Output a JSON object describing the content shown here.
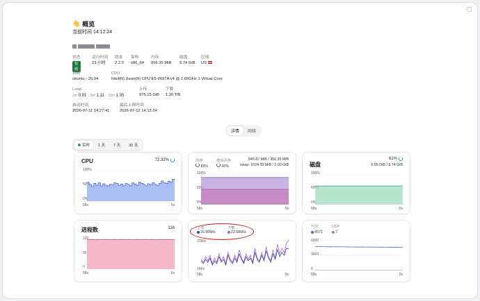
{
  "overview": {
    "title": "概览",
    "time_label": "当前时间",
    "time": "14:12:24"
  },
  "info": {
    "status": {
      "label": "状态",
      "value": "在线"
    },
    "uptime": {
      "label": "运行时间",
      "value": "23 小时"
    },
    "version": {
      "label": "版本",
      "value": "2.2.3"
    },
    "arch": {
      "label": "架构",
      "value": "x86_64"
    },
    "memory": {
      "label": "内存",
      "value": "956.35 MiB"
    },
    "disk": {
      "label": "磁盘",
      "value": "9.74 GiB"
    },
    "region": {
      "label": "区域",
      "value": "US"
    },
    "system": {
      "label": "系统",
      "value": "ubuntu - 26.04"
    },
    "cpu": {
      "label": "CPU",
      "value": "Intel(R) Xeon(R) CPU E5-2697A v4 @ 2.60GHz 1 Virtual Core"
    },
    "load": {
      "label": "Load",
      "l1": "1m",
      "v1": "0.91",
      "l5": "5m",
      "v5": "1.11",
      "l15": "15m",
      "v15": "1.35"
    },
    "upload": {
      "label": "上传",
      "value": "976.15 GiB"
    },
    "download": {
      "label": "下载",
      "value": "1.20 TiB"
    },
    "boot": {
      "label": "启动时间",
      "value": "2026-07-11 14:27:41"
    },
    "last": {
      "label": "最后上报时间",
      "value": "2026-07-12 14:12:24"
    }
  },
  "tabs": {
    "detail": "详情",
    "network": "网络"
  },
  "ranges": [
    "实时",
    "1 天",
    "7 天",
    "30 天"
  ],
  "cpu_card": {
    "title": "CPU",
    "pct": "72.32%",
    "y100": "100%",
    "y50": "50%",
    "y0": "0%",
    "x_start": "58s",
    "x_end": "0s"
  },
  "mem_card": {
    "mem_label": "内存",
    "mem_pct": "89%",
    "swap_label": "虚拟内存",
    "swap_pct": "50%",
    "mem_detail": "846.87 MiB / 956.35 MiB",
    "swap_detail": "swap: 1024.00 MiB / 2.00 GiB",
    "y100": "100%",
    "y50": "50%",
    "y0": "0%",
    "x_start": "58s",
    "x_end": "0s"
  },
  "disk_card": {
    "title": "磁盘",
    "pct": "61%",
    "detail": "5.95 GiB / 9.74 GiB",
    "y100": "100%",
    "y50": "50%",
    "y0": "0%",
    "x_start": "58s",
    "x_end": "0s"
  },
  "proc_card": {
    "title": "进程数",
    "count": "116",
    "y120": "120",
    "y60": "60",
    "y0": "0",
    "x_start": "58s",
    "x_end": "0s"
  },
  "net_card": {
    "up_label": "上传",
    "up_value": "16.60M/s",
    "down_label": "下载",
    "down_value": "22.68M/s",
    "y_top": "23M/s",
    "y_bot": "1M/s",
    "x_start": "58s",
    "x_end": "0s"
  },
  "conn_card": {
    "tcp_label": "TCP",
    "tcp_value": "4571",
    "udp_label": "UDP",
    "udp_value": "7",
    "y6000": "6000",
    "y3000": "3000",
    "y0": "0",
    "x_start": "58s",
    "x_end": "0s"
  },
  "colors": {
    "cpu": "#8ea9f0",
    "mem": "#b59ad8",
    "swap": "#c77fbf",
    "disk": "#9fdcc0",
    "proc": "#f4a0b8",
    "up": "#3b3fa0",
    "down": "#a56bd6",
    "tcp": "#3b6fd0",
    "udp": "#b06fd6"
  },
  "chart_data": {
    "cpu": [
      62,
      55,
      48,
      58,
      52,
      60,
      50,
      57,
      52,
      50,
      55,
      53,
      60,
      58,
      52,
      56,
      50,
      58,
      55,
      50,
      60,
      56,
      52,
      62,
      58,
      55,
      50,
      57,
      53,
      60,
      55,
      52,
      58,
      66,
      60,
      58,
      65,
      62,
      72,
      68
    ],
    "mem": [
      89,
      89,
      89,
      89,
      89,
      89,
      89,
      89,
      89,
      89,
      89,
      89,
      89,
      89,
      89,
      89,
      89,
      89,
      89,
      89,
      89,
      89,
      89,
      89,
      89,
      89,
      89,
      89,
      89,
      89,
      89,
      89,
      89,
      89,
      89,
      89,
      89,
      89,
      89,
      89
    ],
    "swap": [
      50,
      50,
      50,
      50,
      50,
      50,
      50,
      50,
      50,
      50,
      50,
      50,
      50,
      50,
      50,
      50,
      50,
      50,
      50,
      50,
      50,
      50,
      50,
      50,
      50,
      50,
      50,
      50,
      50,
      50,
      50,
      50,
      50,
      50,
      50,
      50,
      50,
      50,
      50,
      50
    ],
    "disk": [
      61,
      61,
      61,
      61,
      61,
      61,
      61,
      61,
      61,
      61,
      61,
      61,
      61,
      61,
      61,
      61,
      61,
      61,
      61,
      61,
      61,
      61,
      61,
      61,
      61,
      61,
      61,
      61,
      61,
      61,
      61,
      61,
      61,
      61,
      61,
      61,
      61,
      61,
      61,
      61
    ],
    "proc": [
      117,
      116,
      117,
      116,
      116,
      117,
      116,
      116,
      117,
      116,
      116,
      116,
      117,
      116,
      116,
      117,
      116,
      116,
      116,
      117,
      116,
      116,
      117,
      116,
      116,
      116,
      117,
      116,
      116,
      117,
      116,
      116,
      116,
      117,
      116,
      116,
      117,
      116,
      116,
      116
    ],
    "net_up": [
      8,
      6,
      9,
      7,
      10,
      5,
      8,
      6,
      11,
      7,
      9,
      5,
      12,
      8,
      6,
      10,
      7,
      13,
      9,
      6,
      11,
      8,
      10,
      6,
      14,
      9,
      7,
      12,
      8,
      15,
      10,
      7,
      13,
      9,
      16,
      11,
      14,
      12,
      17,
      16.6
    ],
    "net_down": [
      9,
      7,
      11,
      8,
      12,
      6,
      10,
      7,
      13,
      8,
      11,
      6,
      14,
      9,
      7,
      12,
      8,
      16,
      10,
      7,
      13,
      9,
      12,
      7,
      17,
      10,
      8,
      14,
      9,
      18,
      11,
      8,
      16,
      10,
      20,
      13,
      17,
      14,
      21,
      22.7
    ],
    "tcp": [
      4700,
      4690,
      4680,
      4700,
      4670,
      4690,
      4660,
      4680,
      4650,
      4670,
      4660,
      4640,
      4660,
      4650,
      4630,
      4650,
      4640,
      4620,
      4640,
      4630,
      4610,
      4630,
      4620,
      4600,
      4620,
      4610,
      4590,
      4610,
      4600,
      4580,
      4600,
      4590,
      4570,
      4590,
      4580,
      4560,
      4580,
      4575,
      4565,
      4571
    ],
    "udp": [
      7,
      7,
      7,
      7,
      7,
      7,
      7,
      7,
      7,
      7,
      7,
      7,
      7,
      7,
      7,
      7,
      7,
      7,
      7,
      7,
      7,
      7,
      7,
      7,
      7,
      7,
      7,
      7,
      7,
      7,
      7,
      7,
      7,
      7,
      7,
      7,
      7,
      7,
      7,
      7
    ]
  }
}
